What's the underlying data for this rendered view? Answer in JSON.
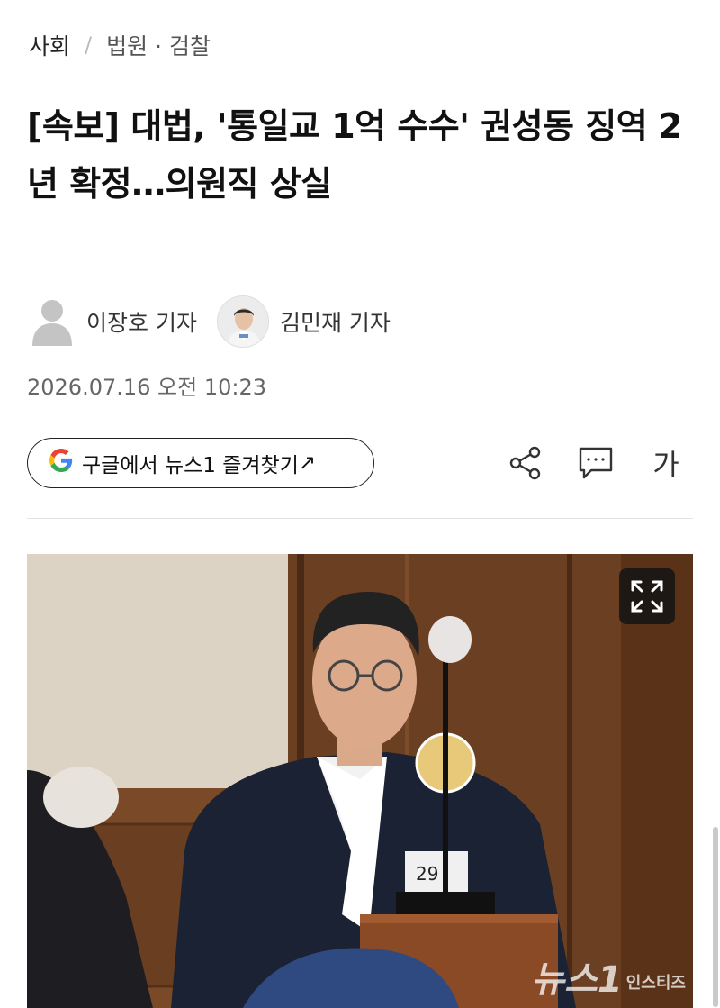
{
  "breadcrumb": {
    "section": "사회",
    "separator": "/",
    "subsection": "법원 · 검찰"
  },
  "article": {
    "title": "[속보] 대법, '통일교 1억 수수' 권성동 징역 2년 확정…의원직 상실",
    "reporters": [
      {
        "name": "이장호 기자",
        "avatar": "default-silhouette"
      },
      {
        "name": "김민재 기자",
        "avatar": "photo"
      }
    ],
    "date": "2026.07.16 오전 10:23"
  },
  "actions": {
    "google_button_label": "구글에서 뉴스1 즐겨찾기",
    "google_button_arrow": "↗",
    "google_logo_letter": "G",
    "font_size_label": "가",
    "icons": [
      "share-icon",
      "comment-icon",
      "font-size-icon"
    ]
  },
  "photo": {
    "watermark_main": "뉴스1",
    "watermark_sub": "인스티즈"
  },
  "colors": {
    "google_blue": "#4285F4",
    "google_red": "#EA4335",
    "google_yellow": "#FBBC05",
    "google_green": "#34A853",
    "text_primary": "#111111",
    "text_secondary": "#666666"
  }
}
